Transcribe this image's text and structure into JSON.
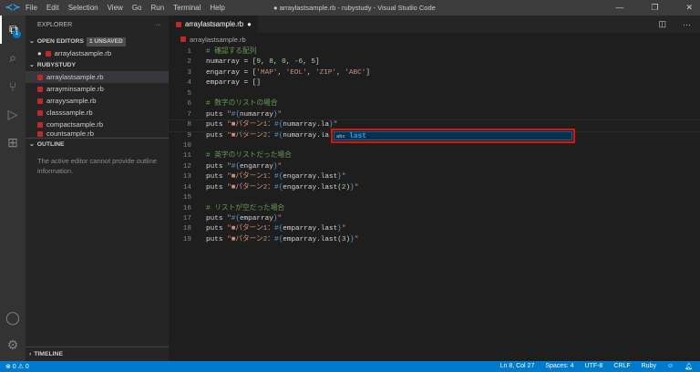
{
  "titlebar": {
    "logo": "VS Code",
    "menu": [
      "File",
      "Edit",
      "Selection",
      "View",
      "Go",
      "Run",
      "Terminal",
      "Help"
    ],
    "title": "● arraylastsample.rb - rubystudy - Visual Studio Code",
    "controls": [
      "—",
      "❐",
      "✕"
    ]
  },
  "activity": {
    "explorer_badge": "1"
  },
  "sidebar": {
    "header": "EXPLORER",
    "more": "···",
    "open_editors": "OPEN EDITORS",
    "unsaved": "1 UNSAVED",
    "open_files": [
      "arraylastsample.rb"
    ],
    "project": "RUBYSTUDY",
    "files": [
      "arraylastsample.rb",
      "arrayminsample.rb",
      "arrayysample.rb",
      "classsample.rb",
      "compactsample.rb",
      "countsample.rb"
    ],
    "outline": "OUTLINE",
    "outline_msg": "The active editor cannot provide outline information.",
    "timeline": "TIMELINE"
  },
  "editor": {
    "tab": "arraylastsample.rb",
    "breadcrumb": "arraylastsample.rb",
    "lines": [
      [
        [
          "c",
          "# 確認する配列"
        ]
      ],
      [
        [
          "t",
          "numarray = ["
        ],
        [
          "n",
          "9"
        ],
        [
          "t",
          ", "
        ],
        [
          "n",
          "8"
        ],
        [
          "t",
          ", "
        ],
        [
          "n",
          "0"
        ],
        [
          "t",
          ", "
        ],
        [
          "n",
          "-6"
        ],
        [
          "t",
          ", "
        ],
        [
          "n",
          "5"
        ],
        [
          "t",
          "]"
        ]
      ],
      [
        [
          "t",
          "engarray = ["
        ],
        [
          "s",
          "'MAP'"
        ],
        [
          "t",
          ", "
        ],
        [
          "s",
          "'EOL'"
        ],
        [
          "t",
          ", "
        ],
        [
          "s",
          "'ZIP'"
        ],
        [
          "t",
          ", "
        ],
        [
          "s",
          "'ABC'"
        ],
        [
          "t",
          "]"
        ]
      ],
      [
        [
          "t",
          "emparray = []"
        ]
      ],
      [],
      [
        [
          "c",
          "# 数字のリストの場合"
        ]
      ],
      [
        [
          "t",
          "puts "
        ],
        [
          "s",
          "\""
        ],
        [
          "p",
          "#{"
        ],
        [
          "t",
          "numarray"
        ],
        [
          "p",
          "}"
        ],
        [
          "s",
          "\""
        ]
      ],
      [
        [
          "t",
          "puts "
        ],
        [
          "s",
          "\"■パターン1："
        ],
        [
          "p",
          "#{"
        ],
        [
          "t",
          "numarray.la"
        ],
        [
          "p",
          "}"
        ],
        [
          "s",
          "\""
        ]
      ],
      [
        [
          "t",
          "puts "
        ],
        [
          "s",
          "\"■パターン2："
        ],
        [
          "p",
          "#{"
        ],
        [
          "t",
          "numarray.la"
        ]
      ],
      [],
      [
        [
          "c",
          "# 英字のリストだった場合"
        ]
      ],
      [
        [
          "t",
          "puts "
        ],
        [
          "s",
          "\""
        ],
        [
          "p",
          "#{"
        ],
        [
          "t",
          "engarray"
        ],
        [
          "p",
          "}"
        ],
        [
          "s",
          "\""
        ]
      ],
      [
        [
          "t",
          "puts "
        ],
        [
          "s",
          "\"■パターン1："
        ],
        [
          "p",
          "#{"
        ],
        [
          "t",
          "engarray.last"
        ],
        [
          "p",
          "}"
        ],
        [
          "s",
          "\""
        ]
      ],
      [
        [
          "t",
          "puts "
        ],
        [
          "s",
          "\"■パターン2："
        ],
        [
          "p",
          "#{"
        ],
        [
          "t",
          "engarray.last("
        ],
        [
          "n",
          "2"
        ],
        [
          "t",
          ")"
        ],
        [
          "p",
          "}"
        ],
        [
          "s",
          "\""
        ]
      ],
      [],
      [
        [
          "c",
          "# リストが空だった場合"
        ]
      ],
      [
        [
          "t",
          "puts "
        ],
        [
          "s",
          "\""
        ],
        [
          "p",
          "#{"
        ],
        [
          "t",
          "emparray"
        ],
        [
          "p",
          "}"
        ],
        [
          "s",
          "\""
        ]
      ],
      [
        [
          "t",
          "puts "
        ],
        [
          "s",
          "\"■パターン1："
        ],
        [
          "p",
          "#{"
        ],
        [
          "t",
          "emparray.last"
        ],
        [
          "p",
          "}"
        ],
        [
          "s",
          "\""
        ]
      ],
      [
        [
          "t",
          "puts "
        ],
        [
          "s",
          "\"■パターン2："
        ],
        [
          "p",
          "#{"
        ],
        [
          "t",
          "emparray.last("
        ],
        [
          "n",
          "3"
        ],
        [
          "t",
          ")"
        ],
        [
          "p",
          "}"
        ],
        [
          "s",
          "\""
        ]
      ]
    ],
    "suggest": {
      "kind": "abc",
      "word": "last"
    }
  },
  "status": {
    "errors": "⊗ 0",
    "warnings": "⚠ 0",
    "position": "Ln 8, Col 27",
    "spaces": "Spaces: 4",
    "encoding": "UTF-8",
    "eol": "CRLF",
    "language": "Ruby"
  },
  "colors": {
    "accent": "#007acc",
    "highlight": "#e51400"
  }
}
